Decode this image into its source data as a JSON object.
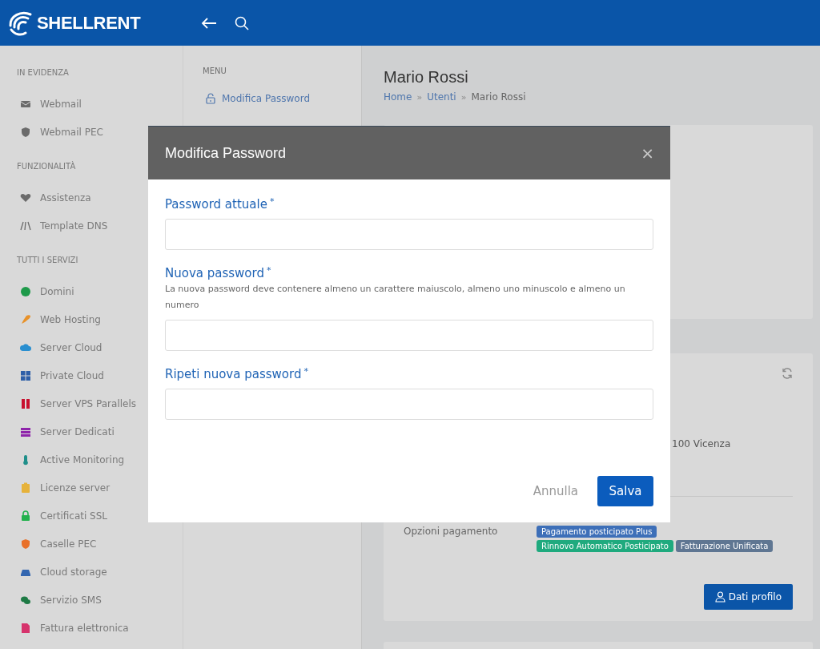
{
  "header": {
    "logo": "SHELLRENT"
  },
  "sidebar": {
    "sections": [
      {
        "title": "IN EVIDENZA",
        "items": [
          {
            "label": "Webmail",
            "color": "#6b6b6b"
          },
          {
            "label": "Webmail PEC",
            "color": "#6b6b6b"
          }
        ]
      },
      {
        "title": "FUNZIONALITÀ",
        "items": [
          {
            "label": "Assistenza",
            "color": "#6b6b6b"
          },
          {
            "label": "Template DNS",
            "color": "#6b6b6b"
          }
        ]
      },
      {
        "title": "TUTTI I SERVIZI",
        "items": [
          {
            "label": "Domini",
            "color": "#1e9a4a"
          },
          {
            "label": "Web Hosting",
            "color": "#e8922a"
          },
          {
            "label": "Server Cloud",
            "color": "#2a8fd0"
          },
          {
            "label": "Private Cloud",
            "color": "#2e5fa8"
          },
          {
            "label": "Server VPS Parallels",
            "color": "#c8102e"
          },
          {
            "label": "Server Dedicati",
            "color": "#8e24aa"
          },
          {
            "label": "Active Monitoring",
            "color": "#1f8f8a"
          },
          {
            "label": "Licenze server",
            "color": "#e6b23a"
          },
          {
            "label": "Certificati SSL",
            "color": "#22b14c"
          },
          {
            "label": "Caselle PEC",
            "color": "#e8702a"
          },
          {
            "label": "Cloud storage",
            "color": "#3366b0"
          },
          {
            "label": "Servizio SMS",
            "color": "#1e7a45"
          },
          {
            "label": "Fattura elettronica",
            "color": "#d6336c"
          }
        ]
      }
    ]
  },
  "submenu": {
    "title": "MENU",
    "items": [
      {
        "label": "Modifica Password"
      }
    ]
  },
  "page": {
    "title": "Mario Rossi",
    "breadcrumb": [
      {
        "label": "Home",
        "link": true
      },
      {
        "separator": "»",
        "label": "Utenti",
        "link": true
      },
      {
        "separator": "»",
        "label": "Mario Rossi",
        "link": false
      }
    ]
  },
  "profile_card": {
    "address_fragment": "100 Vicenza",
    "options_label": "Opzioni pagamento",
    "badges": [
      {
        "label": "Pagamento posticipato Plus",
        "color": "#3d6fb8"
      },
      {
        "label": "Rinnovo Automatico Posticipato",
        "color": "#1faa7e"
      },
      {
        "label": "Fatturazione Unificata",
        "color": "#5f7692"
      }
    ],
    "button": "Dati profilo"
  },
  "modal": {
    "title": "Modifica Password",
    "close": "×",
    "fields": [
      {
        "label": "Password attuale",
        "required_mark": "*"
      },
      {
        "label": "Nuova password",
        "required_mark": "*",
        "help": "La nuova password deve contenere almeno un carattere maiuscolo, almeno uno minuscolo e almeno un numero"
      },
      {
        "label": "Ripeti nuova password",
        "required_mark": "*"
      }
    ],
    "cancel": "Annulla",
    "submit": "Salva"
  }
}
